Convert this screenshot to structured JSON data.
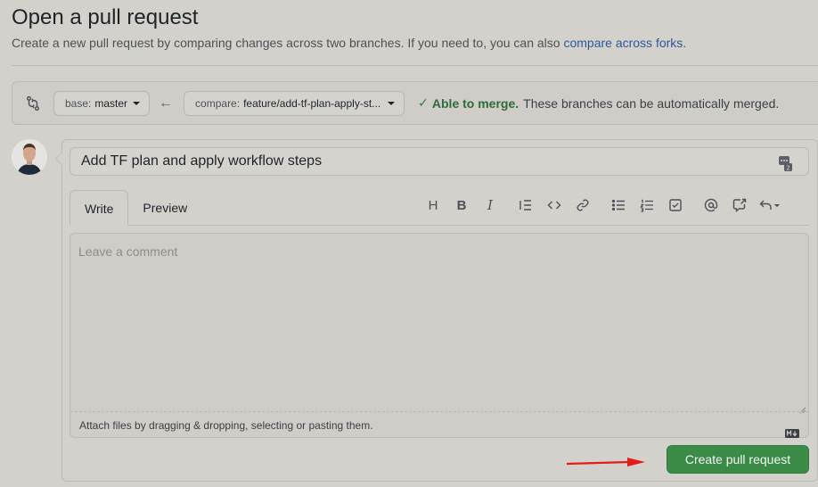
{
  "page": {
    "title": "Open a pull request",
    "subtitle": "Create a new pull request by comparing changes across two branches. If you need to, you can also ",
    "subtitle_link": "compare across forks",
    "subtitle_end": "."
  },
  "range": {
    "base_prefix": "base:",
    "base_value": "master",
    "compare_prefix": "compare:",
    "compare_value": "feature/add-tf-plan-apply-st...",
    "merge_ok": "Able to merge.",
    "merge_msg": "These branches can be automatically merged."
  },
  "form": {
    "title_value": "Add TF plan and apply workflow steps",
    "tabs": [
      {
        "label": "Write",
        "active": true
      },
      {
        "label": "Preview",
        "active": false
      }
    ],
    "toolbar_icons": [
      "heading-icon",
      "bold-icon",
      "italic-icon",
      "quote-icon",
      "code-icon",
      "link-icon",
      "bulleted-list-icon",
      "numbered-list-icon",
      "task-list-icon",
      "mention-icon",
      "reference-icon",
      "reply-icon"
    ],
    "comment_placeholder": "Leave a comment",
    "attach_text": "Attach files by dragging & dropping, selecting or pasting them.",
    "submit_label": "Create pull request"
  },
  "colors": {
    "accent_green": "#3a8a48",
    "link_blue": "#2b5a9a",
    "annotation_red": "#e21b1b"
  }
}
